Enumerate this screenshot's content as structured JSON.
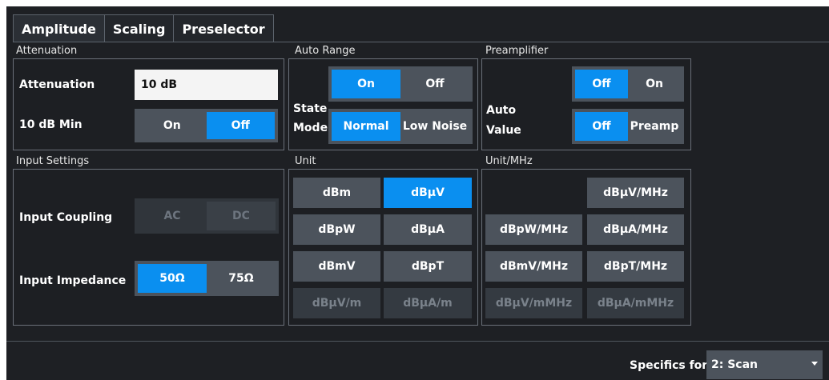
{
  "tabs": [
    "Amplitude",
    "Scaling",
    "Preselector"
  ],
  "attenuation": {
    "title": "Attenuation",
    "attenuation_label": "Attenuation",
    "attenuation_value": "10 dB",
    "min_label": "10 dB Min",
    "min_options": [
      "On",
      "Off"
    ],
    "min_selected": "Off"
  },
  "auto_range": {
    "title": "Auto Range",
    "state_label": "State",
    "state_options": [
      "On",
      "Off"
    ],
    "state_selected": "On",
    "mode_label": "Mode",
    "mode_options": [
      "Normal",
      "Low Noise"
    ],
    "mode_selected": "Normal"
  },
  "preamplifier": {
    "title": "Preamplifier",
    "auto_label": "Auto",
    "auto_options": [
      "Off",
      "On"
    ],
    "auto_selected": "Off",
    "value_label": "Value",
    "value_options": [
      "Off",
      "Preamp"
    ],
    "value_selected": "Off"
  },
  "input_settings": {
    "title": "Input Settings",
    "coupling_label": "Input Coupling",
    "coupling_options": [
      "AC",
      "DC"
    ],
    "coupling_enabled": false,
    "impedance_label": "Input Impedance",
    "impedance_options": [
      "50Ω",
      "75Ω"
    ],
    "impedance_selected": "50Ω"
  },
  "unit": {
    "title": "Unit",
    "buttons": [
      "dBm",
      "dBμV",
      "dBpW",
      "dBμA",
      "dBmV",
      "dBpT",
      "dBμV/m",
      "dBμA/m"
    ],
    "selected": "dBμV",
    "disabled": [
      "dBμV/m",
      "dBμA/m"
    ]
  },
  "unit_mhz": {
    "title": "Unit/MHz",
    "buttons": [
      "dBμV/MHz",
      "dBpW/MHz",
      "dBμA/MHz",
      "dBmV/MHz",
      "dBpT/MHz",
      "dBμV/mMHz",
      "dBμA/mMHz"
    ],
    "disabled": [
      "dBμV/mMHz",
      "dBμA/mMHz"
    ]
  },
  "footer": {
    "specifics_label": "Specifics for",
    "specifics_value": "2: Scan"
  },
  "colors": {
    "selected": "#0a8ff0",
    "button": "#4c535c",
    "background": "#1e2024"
  }
}
